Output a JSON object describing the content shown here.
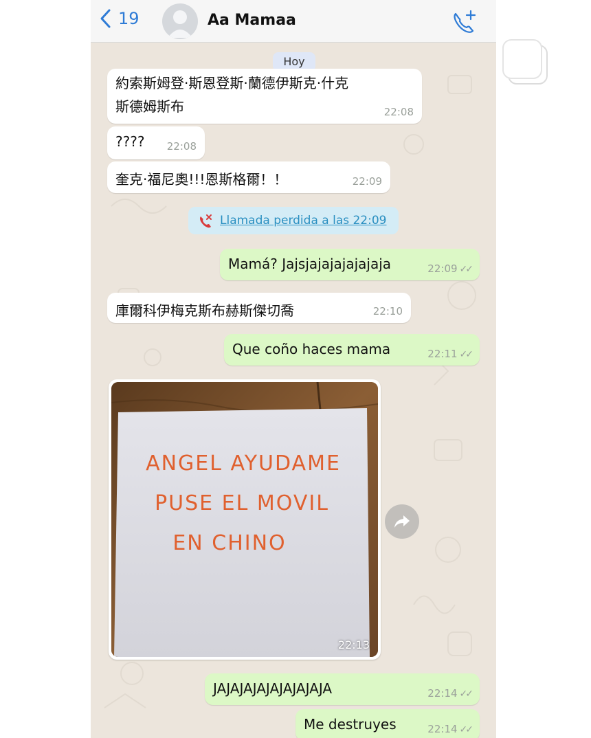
{
  "header": {
    "back_count": "19",
    "contact_name": "Aa Mamaa"
  },
  "date_chip": "Hoy",
  "messages": [
    {
      "direction": "in",
      "text_line1": "約索斯姆登·斯恩登斯·蘭德伊斯克·什克",
      "text_line2": "斯德姆斯布",
      "time": "22:08"
    },
    {
      "direction": "in",
      "text": "????",
      "time": "22:08"
    },
    {
      "direction": "in",
      "text": "奎克·福尼奧!!!恩斯格爾！！",
      "time": "22:09"
    },
    {
      "direction": "out",
      "text": "Mamá? Jajsjajajajajajaja",
      "time": "22:09"
    },
    {
      "direction": "in",
      "text": "庫爾科伊梅克斯布赫斯傑切喬",
      "time": "22:10"
    },
    {
      "direction": "out",
      "text": "Que coño haces mama",
      "time": "22:11"
    },
    {
      "direction": "out",
      "text": "JAJAJAJAJAJAJAJAJA",
      "time": "22:14"
    },
    {
      "direction": "out",
      "text": "Me destruyes",
      "time": "22:14"
    }
  ],
  "missed_call": "Llamada perdida a las 22:09",
  "photo": {
    "time": "22:13",
    "note_line1": "ANGEL AYUDAME",
    "note_line2": "PUSE EL MOVIL",
    "note_line3": "EN CHINO"
  },
  "colors": {
    "incoming_bubble": "#ffffff",
    "outgoing_bubble": "#dcf8c6",
    "chat_background": "#ece5dc",
    "accent_blue": "#2e7bd6",
    "missed_call_red": "#d93a3a",
    "note_ink": "#e0602e"
  },
  "icons": {
    "back": "chevron-left-icon",
    "call": "phone-plus-icon",
    "missed": "missed-call-icon",
    "forward": "forward-arrow-icon"
  }
}
